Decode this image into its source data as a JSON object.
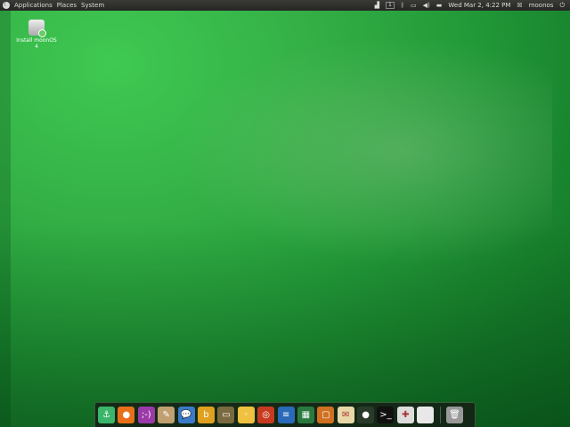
{
  "panel": {
    "menus": [
      "Applications",
      "Places",
      "System"
    ],
    "workspace": "1",
    "clock": "Wed Mar  2,  4:22 PM",
    "user": "moonos"
  },
  "desktop": {
    "icon_label": "Install moonOS 4"
  },
  "dock": {
    "items": [
      {
        "name": "anchor",
        "color": "#3bb56a",
        "glyph": "⚓"
      },
      {
        "name": "firefox",
        "color": "#e8701a",
        "glyph": "●"
      },
      {
        "name": "empathy",
        "color": "#9a3aa8",
        "glyph": ";-)"
      },
      {
        "name": "paint",
        "color": "#c0a070",
        "glyph": "✎"
      },
      {
        "name": "pidgin",
        "color": "#3a7ac8",
        "glyph": "💬"
      },
      {
        "name": "banshee",
        "color": "#e0a020",
        "glyph": "b"
      },
      {
        "name": "monitor",
        "color": "#7a6a40",
        "glyph": "▭"
      },
      {
        "name": "cheese",
        "color": "#f0c040",
        "glyph": "◦"
      },
      {
        "name": "music",
        "color": "#c83a20",
        "glyph": "◎"
      },
      {
        "name": "writer",
        "color": "#2a6ab8",
        "glyph": "≡"
      },
      {
        "name": "calc",
        "color": "#2a7a40",
        "glyph": "▦"
      },
      {
        "name": "impress",
        "color": "#d07020",
        "glyph": "▢"
      },
      {
        "name": "mail",
        "color": "#e8d8a8",
        "glyph": "✉"
      },
      {
        "name": "webcam",
        "color": "#2a3a2a",
        "glyph": "●"
      },
      {
        "name": "terminal",
        "color": "#111111",
        "glyph": ">_"
      },
      {
        "name": "settings",
        "color": "#dddddd",
        "glyph": "✚"
      },
      {
        "name": "blank",
        "color": "#e8e8e8",
        "glyph": ""
      }
    ],
    "trash": {
      "color": "#999999",
      "glyph": "🗑"
    }
  }
}
